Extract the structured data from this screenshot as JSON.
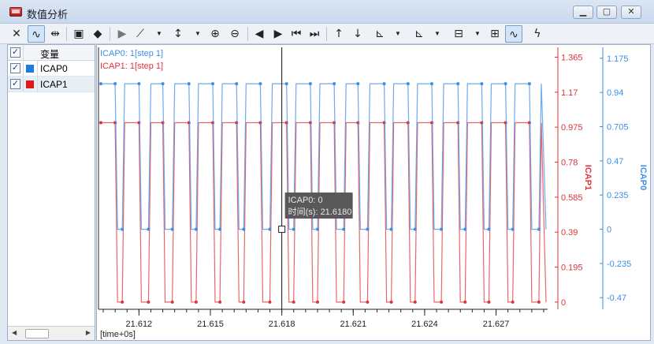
{
  "window": {
    "title": "数值分析"
  },
  "colors": {
    "icap0": "#3d8ee6",
    "icap1": "#e0333a",
    "blue_axis": "#2f8be0",
    "red_axis": "#e0333a",
    "tooltip_bg": "#595959"
  },
  "toolbar": {
    "buttons": [
      "close-icon",
      "waveform-icon",
      "cursor-icon",
      "save-icon",
      "eraser-icon",
      "play-icon",
      "chart-icon",
      "axis-xy-icon",
      "zoom-in-xy-icon",
      "zoom-out-xy-icon",
      "prev-icon",
      "next-icon",
      "first-icon",
      "last-icon",
      "rising-edge-icon",
      "falling-edge-icon",
      "measure-icon",
      "axis-settings-icon",
      "layout-icon",
      "grid-icon",
      "signal-view-icon",
      "lightning-icon"
    ]
  },
  "variables": {
    "header": "变量",
    "items": [
      {
        "name": "ICAP0",
        "checked": "✓",
        "color": "#1e7be0"
      },
      {
        "name": "ICAP1",
        "checked": "✓",
        "color": "#e01818"
      }
    ]
  },
  "chart_data": {
    "type": "line",
    "series": [
      {
        "name": "ICAP0",
        "legend": "ICAP0: 1[step 1]",
        "color": "#3d8ee6",
        "x": [
          21.6103,
          21.6104,
          21.611,
          21.6111,
          21.6113,
          21.6114,
          21.612,
          21.6121,
          21.6124,
          21.6125,
          21.613,
          21.6131,
          21.6134,
          21.6135,
          21.6141,
          21.6142,
          21.6144,
          21.6145,
          21.6151,
          21.6152,
          21.6154,
          21.6155,
          21.6161,
          21.6162,
          21.6164,
          21.6165,
          21.6171,
          21.6172,
          21.6175,
          21.6176,
          21.6182,
          21.6183,
          21.6185,
          21.6186,
          21.6192,
          21.6193,
          21.6195,
          21.6196,
          21.6202,
          21.6203,
          21.6206,
          21.6207,
          21.6212,
          21.6213,
          21.6216,
          21.6217,
          21.6223,
          21.6224,
          21.6226,
          21.6227,
          21.6233,
          21.6234,
          21.6236,
          21.6237,
          21.6243,
          21.6244,
          21.6247,
          21.6248,
          21.6254,
          21.6255,
          21.6257,
          21.6258,
          21.6264,
          21.6265,
          21.6267,
          21.6268,
          21.6274,
          21.6275,
          21.6277,
          21.6278,
          21.6284,
          21.6285,
          21.6288,
          21.6289,
          21.6291
        ],
        "y": [
          1,
          1,
          1,
          0,
          0,
          1,
          1,
          0,
          0,
          1,
          1,
          0,
          0,
          1,
          1,
          0,
          0,
          1,
          1,
          0,
          0,
          1,
          1,
          0,
          0,
          1,
          1,
          0,
          0,
          1,
          1,
          0,
          0,
          1,
          1,
          0,
          0,
          1,
          1,
          0,
          0,
          1,
          1,
          0,
          0,
          1,
          1,
          0,
          0,
          1,
          1,
          0,
          0,
          1,
          1,
          0,
          0,
          1,
          1,
          0,
          0,
          1,
          1,
          0,
          0,
          1,
          1,
          0,
          0,
          1,
          1,
          0,
          0,
          1,
          0
        ]
      },
      {
        "name": "ICAP1",
        "legend": "ICAP1: 1[step 1]",
        "color": "#e0333a",
        "y": [
          1,
          1,
          1,
          0,
          0,
          1,
          1,
          0,
          0,
          1,
          1,
          0,
          0,
          1,
          1,
          0,
          0,
          1,
          1,
          0,
          0,
          1,
          1,
          0,
          0,
          1,
          1,
          0,
          0,
          1,
          1,
          0,
          0,
          1,
          1,
          0,
          0,
          1,
          1,
          0,
          0,
          1,
          1,
          0,
          0,
          1,
          1,
          0,
          0,
          1,
          1,
          0,
          0,
          1,
          1,
          0,
          0,
          1,
          1,
          0,
          0,
          1,
          1,
          0,
          0,
          1,
          1,
          0,
          0,
          1,
          1,
          0,
          0,
          1,
          0
        ]
      }
    ],
    "x_ticks": [
      "21.612",
      "21.615",
      "21.618",
      "21.621",
      "21.624",
      "21.627"
    ],
    "x_tick_values": [
      21.612,
      21.615,
      21.618,
      21.621,
      21.624,
      21.627
    ],
    "xlim": [
      21.6103,
      21.6291
    ],
    "xlabel": "[time+0s]",
    "red_axis": {
      "label": "ICAP1",
      "ticks": [
        "1.365",
        "1.17",
        "0.975",
        "0.78",
        "0.585",
        "0.39",
        "0.195",
        "0"
      ],
      "tick_values": [
        1.365,
        1.17,
        0.975,
        0.78,
        0.585,
        0.39,
        0.195,
        0
      ],
      "range": [
        -0.04,
        1.42
      ]
    },
    "blue_axis": {
      "label": "ICAP0",
      "ticks": [
        "1.175",
        "0.94",
        "0.705",
        "0.47",
        "0.235",
        "0",
        "-0.235",
        "-0.47"
      ],
      "tick_values": [
        1.175,
        0.94,
        0.705,
        0.47,
        0.235,
        0,
        -0.235,
        -0.47
      ],
      "range": [
        -0.55,
        1.25
      ]
    },
    "cursor": {
      "x": 21.618,
      "tooltip_line1": "ICAP0: 0",
      "tooltip_line2": "时间(s): 21.6180"
    },
    "grid": false
  }
}
